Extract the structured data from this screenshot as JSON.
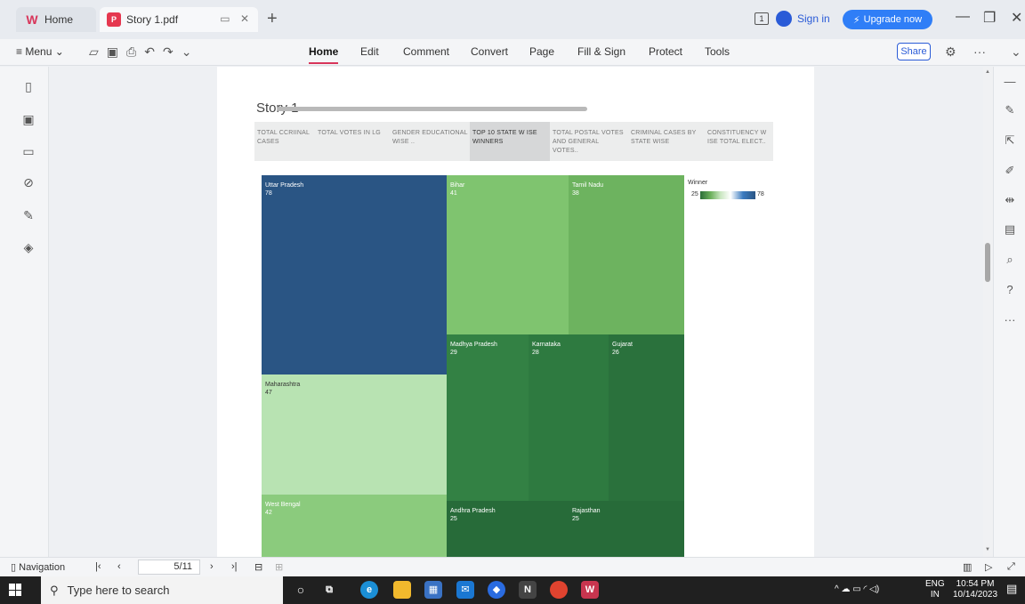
{
  "tabs": [
    {
      "label": "Home",
      "icon": "wps-logo-icon"
    },
    {
      "label": "Story 1.pdf",
      "icon": "pdf-file-icon"
    }
  ],
  "titlebar": {
    "sign_in": "Sign in",
    "upgrade": "Upgrade now"
  },
  "toolbar": {
    "menu": "Menu",
    "ribbon": [
      "Home",
      "Edit",
      "Comment",
      "Convert",
      "Page",
      "Fill & Sign",
      "Protect",
      "Tools"
    ],
    "active": "Home",
    "share": "Share"
  },
  "page": {
    "title": "Story 1",
    "story_tabs": [
      "TOTAL CCRIINAL CASES",
      "TOTAL VOTES IN LG",
      "GENDER EDUCATIONAL WISE ..",
      "TOP 10 STATE W ISE WINNERS",
      "TOTAL POSTAL VOTES AND GENERAL VOTES..",
      "CRIMINAL CASES BY STATE WISE",
      "CONSTITUENCY W ISE TOTAL ELECT.."
    ],
    "active_story_tab": 3
  },
  "chart_data": {
    "type": "treemap",
    "legend_title": "Winner",
    "color_range": [
      25,
      78
    ],
    "items": [
      {
        "name": "Uttar Pradesh",
        "value": 78,
        "color": "#2a5584"
      },
      {
        "name": "Maharashtra",
        "value": 47,
        "color": "#b8e3b2"
      },
      {
        "name": "West Bengal",
        "value": 42,
        "color": "#8bcb7d"
      },
      {
        "name": "Bihar",
        "value": 41,
        "color": "#7fc46f"
      },
      {
        "name": "Tamil Nadu",
        "value": 38,
        "color": "#6db35f"
      },
      {
        "name": "Madhya Pradesh",
        "value": 29,
        "color": "#338144"
      },
      {
        "name": "Karnataka",
        "value": 28,
        "color": "#2e7a40"
      },
      {
        "name": "Gujarat",
        "value": 26,
        "color": "#2a713c"
      },
      {
        "name": "Andhra Pradesh",
        "value": 25,
        "color": "#276b39"
      },
      {
        "name": "Rajasthan",
        "value": 25,
        "color": "#276b39"
      }
    ]
  },
  "statusbar": {
    "navigation": "Navigation",
    "page_indicator": "5/11"
  },
  "taskbar": {
    "search_placeholder": "Type here to search",
    "lang": "ENG",
    "region": "IN",
    "time": "10:54 PM",
    "date": "10/14/2023"
  }
}
